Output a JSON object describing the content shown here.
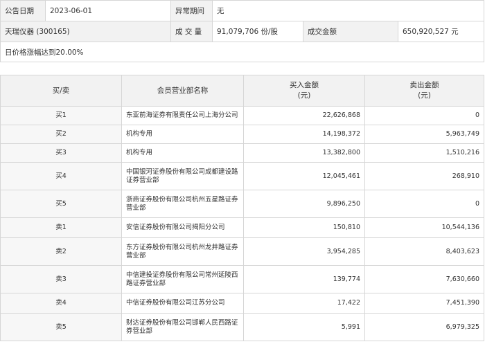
{
  "header": {
    "date_label": "公告日期",
    "date_value": "2023-06-01",
    "period_label": "异常期间",
    "period_value": "无",
    "stock_name": "天瑞仪器 (300165)",
    "volume_label": "成 交 量",
    "volume_value": "91,079,706 份/股",
    "amount_label": "成交金额",
    "amount_value": "650,920,527 元",
    "note": "日价格涨幅达到20.00%"
  },
  "table": {
    "columns": {
      "side": "买/卖",
      "branch": "会员营业部名称",
      "buy_amount": "买入金额",
      "buy_unit": "(元)",
      "sell_amount": "卖出金额",
      "sell_unit": "(元)"
    },
    "rows": [
      {
        "side": "买1",
        "branch": "东亚前海证券有限责任公司上海分公司",
        "buy": "22,626,868",
        "sell": "0"
      },
      {
        "side": "买2",
        "branch": "机构专用",
        "buy": "14,198,372",
        "sell": "5,963,749"
      },
      {
        "side": "买3",
        "branch": "机构专用",
        "buy": "13,382,800",
        "sell": "1,510,216"
      },
      {
        "side": "买4",
        "branch": "中国银河证券股份有限公司成都建设路证券营业部",
        "buy": "12,045,461",
        "sell": "268,910"
      },
      {
        "side": "买5",
        "branch": "浙商证券股份有限公司杭州五星路证券营业部",
        "buy": "9,896,250",
        "sell": "0"
      },
      {
        "side": "卖1",
        "branch": "安信证券股份有限公司揭阳分公司",
        "buy": "150,810",
        "sell": "10,544,136"
      },
      {
        "side": "卖2",
        "branch": "东方证券股份有限公司杭州龙井路证券营业部",
        "buy": "3,954,285",
        "sell": "8,403,623"
      },
      {
        "side": "卖3",
        "branch": "中信建投证券股份有限公司常州延陵西路证券营业部",
        "buy": "139,774",
        "sell": "7,630,660"
      },
      {
        "side": "卖4",
        "branch": "中信证券股份有限公司江苏分公司",
        "buy": "17,422",
        "sell": "7,451,390"
      },
      {
        "side": "卖5",
        "branch": "财达证券股份有限公司邯郸人民西路证券营业部",
        "buy": "5,991",
        "sell": "6,979,325"
      }
    ]
  }
}
